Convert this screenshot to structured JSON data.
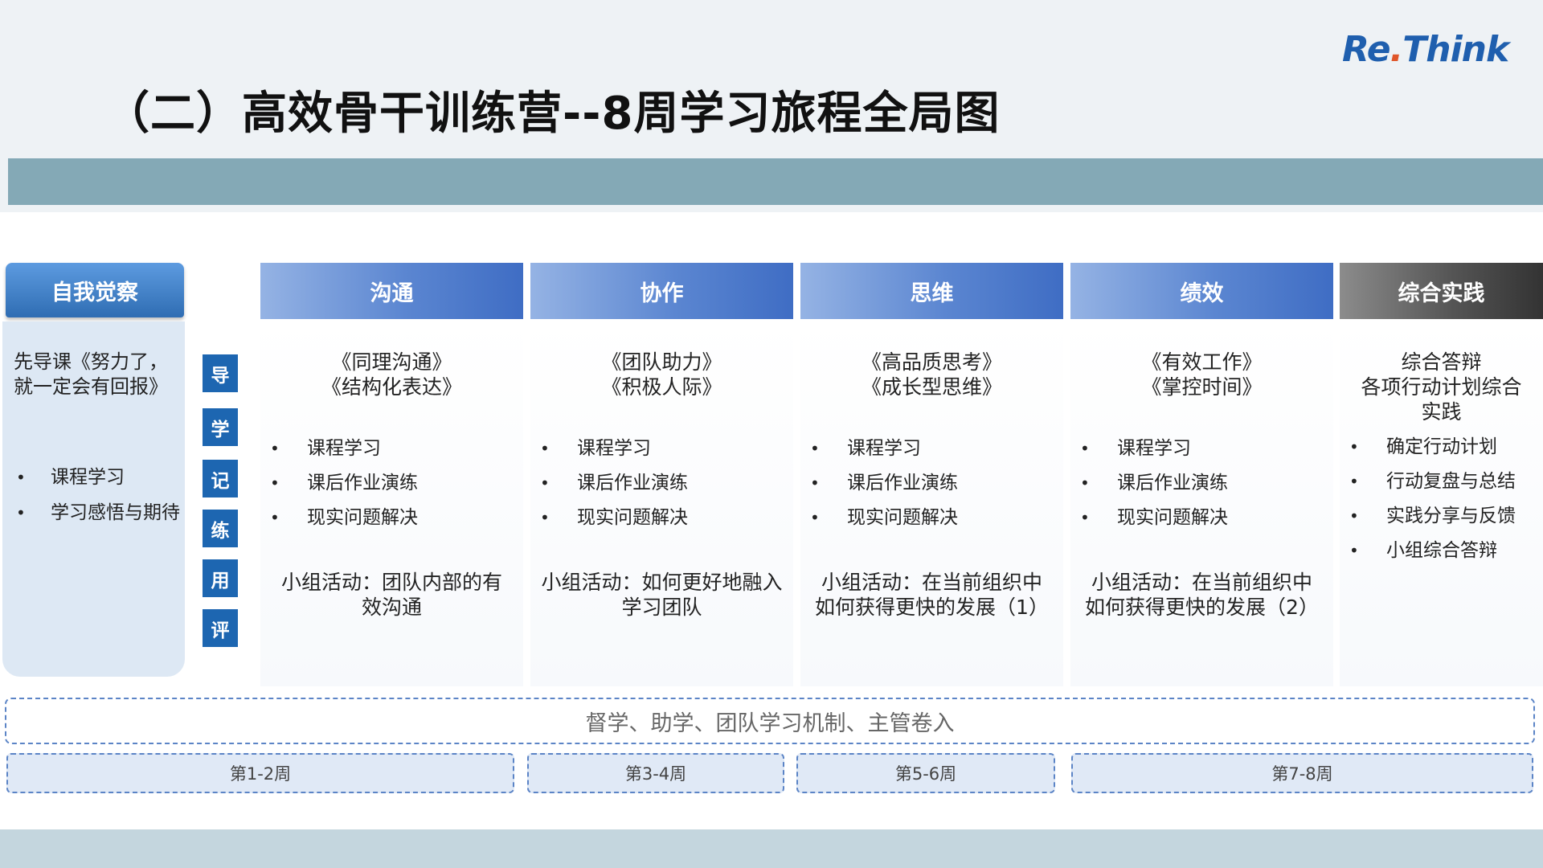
{
  "title": "（二）高效骨干训练营--8周学习旅程全局图",
  "logo": {
    "part1": "Re",
    "part2": ".",
    "part3": "Think"
  },
  "colors": {
    "accent_blue": "#3f6dc4",
    "step_blue": "#1d66b1",
    "dark_head": "#333333",
    "title_bar": "#84a9b6",
    "logo_blue": "#1f5fae",
    "logo_orange": "#e0562a"
  },
  "self_column": {
    "header": "自我觉察",
    "intro": [
      "先导课《努力了，",
      "就一定会有回报》"
    ],
    "items": [
      "课程学习",
      "学习感悟与期待"
    ]
  },
  "steps": [
    "导",
    "学",
    "记",
    "练",
    "用",
    "评"
  ],
  "columns": [
    {
      "header": "沟通",
      "courses": [
        "《同理沟通》",
        "《结构化表达》"
      ],
      "items": [
        "课程学习",
        "课后作业演练",
        "现实问题解决"
      ],
      "activity": [
        "小组活动：团队内部的有",
        "效沟通"
      ]
    },
    {
      "header": "协作",
      "courses": [
        "《团队助力》",
        "《积极人际》"
      ],
      "items": [
        "课程学习",
        "课后作业演练",
        "现实问题解决"
      ],
      "activity": [
        "小组活动：如何更好地融入",
        "学习团队"
      ]
    },
    {
      "header": "思维",
      "courses": [
        "《高品质思考》",
        "《成长型思维》"
      ],
      "items": [
        "课程学习",
        "课后作业演练",
        "现实问题解决"
      ],
      "activity": [
        "小组活动：在当前组织中",
        "如何获得更快的发展（1）"
      ]
    },
    {
      "header": "绩效",
      "courses": [
        "《有效工作》",
        "《掌控时间》"
      ],
      "items": [
        "课程学习",
        "课后作业演练",
        "现实问题解决"
      ],
      "activity": [
        "小组活动：在当前组织中",
        "如何获得更快的发展（2）"
      ]
    },
    {
      "header": "综合实践",
      "courses": [
        "综合答辩",
        "各项行动计划综合",
        "实践"
      ],
      "items": [
        "确定行动计划",
        "行动复盘与总结",
        "实践分享与反馈",
        "小组综合答辩"
      ],
      "activity": []
    }
  ],
  "support_text": "督学、助学、团队学习机制、主管卷入",
  "weeks": [
    "第1-2周",
    "第3-4周",
    "第5-6周",
    "第7-8周"
  ]
}
